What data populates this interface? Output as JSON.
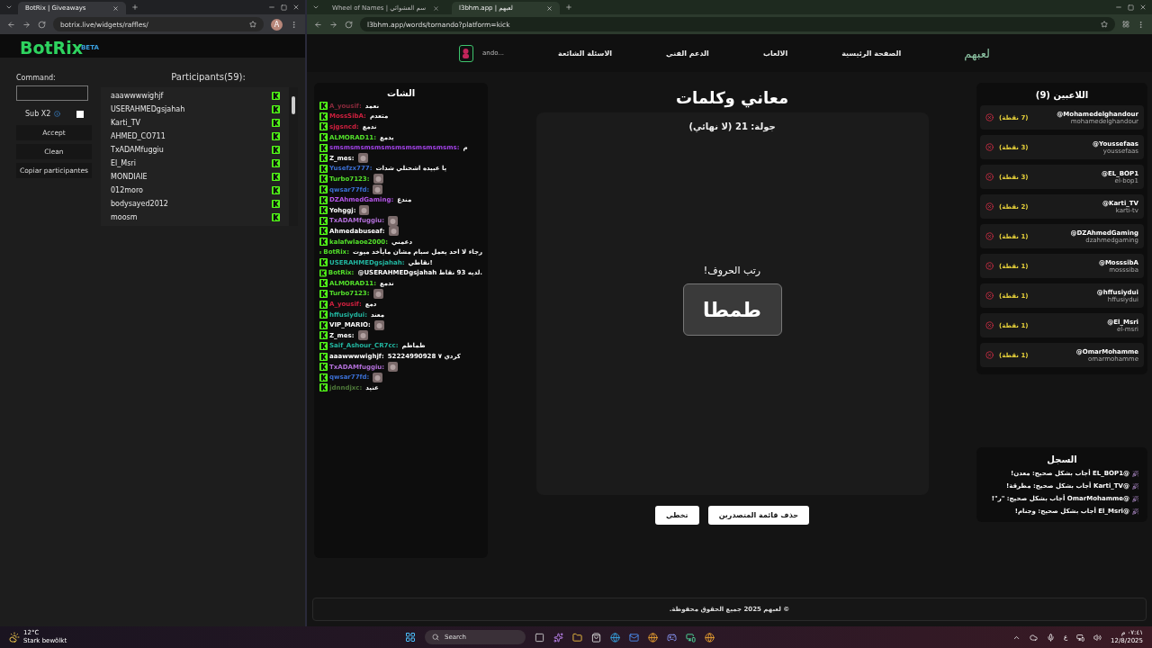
{
  "left_window": {
    "tab_title": "BotRix | Giveaways",
    "url": "botrix.live/widgets/raffles/",
    "profile_initial": "A",
    "logo": "BotRix",
    "logo_badge": "BETA",
    "command_label": "Command:",
    "sub_label": "Sub X2",
    "sub_checked": false,
    "buttons": [
      "Accept",
      "Clean",
      "Copiar participantes"
    ],
    "participants_title": "Participants(59):",
    "participants": [
      "aaawwwwighjf",
      "USERAHMEDgsjahah",
      "Karti_TV",
      "AHMED_CO711",
      "TxADAMfuggiu",
      "El_Msri",
      "MONDIAIE",
      "012moro",
      "bodysayed2012",
      "moosm"
    ]
  },
  "right_window": {
    "background_tab": {
      "title": "Wheel of Names | سم العشوائي"
    },
    "active_tab": {
      "title": "l3bhm.app | لعبهم"
    },
    "url": "l3bhm.app/words/tornando?platform=kick"
  },
  "nav": {
    "logo": "لعبهم",
    "links": [
      "الصفحة الرئيسية",
      "الالعاب",
      "الدعم الفني",
      "الاسئلة الشائعة"
    ],
    "user": "...ando"
  },
  "chat": {
    "title": "الشات",
    "messages": [
      {
        "kind": "text",
        "user": "A_yousif:",
        "color": "#8a2a3c",
        "text": "نعمد"
      },
      {
        "kind": "text",
        "user": "MossSibA:",
        "color": "#d0203f",
        "text": "متعدم"
      },
      {
        "kind": "text",
        "user": "sjgsncd:",
        "color": "#d0203f",
        "text": "ندمع"
      },
      {
        "kind": "text",
        "user": "ALMORAD11:",
        "color": "#53e02b",
        "text": "يدمع"
      },
      {
        "kind": "text",
        "user": "smsmsmsmsmsmsmsmsmsmsmsms:",
        "color": "#a142e6",
        "text": "م"
      },
      {
        "kind": "emote",
        "user": "Z_mes:",
        "color": "#ffffff"
      },
      {
        "kind": "text",
        "user": "Yusefzx777:",
        "color": "#3b6fd4",
        "text": "يا عبيده اشحنلي شدات"
      },
      {
        "kind": "emote",
        "user": "Turbo7123:",
        "color": "#53e02b"
      },
      {
        "kind": "emote",
        "user": "qwsar77fd:",
        "color": "#3b6fd4"
      },
      {
        "kind": "text",
        "user": "DZAhmedGaming:",
        "color": "#b455e8",
        "text": "مندع"
      },
      {
        "kind": "emote",
        "user": "Yohggj:",
        "color": "#ffffff"
      },
      {
        "kind": "emote",
        "user": "TxADAMfuggiu:",
        "color": "#b26fd9"
      },
      {
        "kind": "emote",
        "user": "Ahmedabuseaf:",
        "color": "#ffffff"
      },
      {
        "kind": "text",
        "user": "kalafwlaoe2000:",
        "color": "#53e02b",
        "text": "دعمني"
      },
      {
        "kind": "text",
        "user": "BotRix:",
        "color": "#53e02b",
        "text": "رجاء لا احد يعمل سبام مشان مايأخد ميوت"
      },
      {
        "kind": "text",
        "user": "USERAHMEDgsjahah:",
        "color": "#22b7a1",
        "text": "نقاطي!"
      },
      {
        "kind": "text",
        "user": "BotRix:",
        "color": "#53e02b",
        "text": "@USERAHMEDgsjahah لديه 93 نقاط."
      },
      {
        "kind": "text",
        "user": "ALMORAD11:",
        "color": "#53e02b",
        "text": "ندمع"
      },
      {
        "kind": "emote",
        "user": "Turbo7123:",
        "color": "#53e02b"
      },
      {
        "kind": "text",
        "user": "A_yousif:",
        "color": "#d0203f",
        "text": "دمع"
      },
      {
        "kind": "text",
        "user": "hffusiydui:",
        "color": "#22b7a1",
        "text": "معند"
      },
      {
        "kind": "emote",
        "user": "VIP_MARIO:",
        "color": "#ffffff"
      },
      {
        "kind": "emote",
        "user": "Z_mes:",
        "color": "#ffffff"
      },
      {
        "kind": "text",
        "user": "Saif_Ashour_CR7cc:",
        "color": "#22b7a1",
        "text": "طماطم"
      },
      {
        "kind": "text",
        "user": "aaawwwwighjf:",
        "color": "#ffffff",
        "text": "52224990928 كردي ٧"
      },
      {
        "kind": "emote",
        "user": "TxADAMfuggiu:",
        "color": "#b26fd9"
      },
      {
        "kind": "emote",
        "user": "qwsar77fd:",
        "color": "#3b6fd4"
      },
      {
        "kind": "text",
        "user": "jdnndjxc:",
        "color": "#4f7a3a",
        "text": "عنيد"
      }
    ]
  },
  "game": {
    "title": "معاني وكلمات",
    "round": "جولة: 21 (لا نهائي)",
    "prompt": "رتب الحروف!",
    "word": "طمطا",
    "buttons": [
      "حذف قائمة المتصدرين",
      "تخطي"
    ]
  },
  "players": {
    "title": "اللاعبين (9)",
    "items": [
      {
        "name": "@Mohamedelghandour",
        "handle": "mohamedelghandour",
        "points": "(7 نقطة)"
      },
      {
        "name": "@Youssefaas",
        "handle": "youssefaas",
        "points": "(3 نقطة)"
      },
      {
        "name": "@EL_BOP1",
        "handle": "el-bop1",
        "points": "(3 نقطة)"
      },
      {
        "name": "@Karti_TV",
        "handle": "karti-tv",
        "points": "(2 نقطة)"
      },
      {
        "name": "@DZAhmedGaming",
        "handle": "dzahmedgaming",
        "points": "(1 نقطة)"
      },
      {
        "name": "@MosssibA",
        "handle": "mosssiba",
        "points": "(1 نقطة)"
      },
      {
        "name": "@hffusiydui",
        "handle": "hffusiydui",
        "points": "(1 نقطة)"
      },
      {
        "name": "@El_Msri",
        "handle": "el-msri",
        "points": "(1 نقطة)"
      },
      {
        "name": "@OmarMohamme",
        "handle": "omarmohamme",
        "points": "(1 نقطة)"
      }
    ]
  },
  "log": {
    "title": "السجل",
    "entries": [
      "@EL_BOP1 أجاب بشكل صحيح: معدن!",
      "@Karti_TV أجاب بشكل صحيح: مطرقة!",
      "@OmarMohamme أجاب بشكل صحيح: \"ر\"!",
      "@El_Msri أجاب بشكل صحيح: وجنام!"
    ]
  },
  "footer": "© لعبهم 2025 جميع الحقوق محفوظة.",
  "taskbar": {
    "temperature": "12°C",
    "weather": "Stark bewölkt",
    "search": "Search",
    "language": "ع",
    "time": "٠٧:٤١ م",
    "date": "12/8/2025"
  }
}
